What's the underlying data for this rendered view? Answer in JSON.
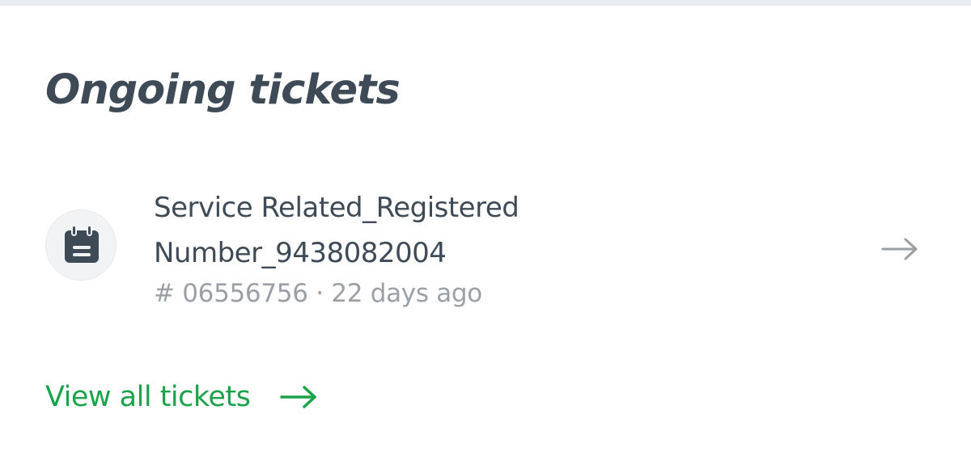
{
  "section": {
    "title": "Ongoing tickets"
  },
  "ticket": {
    "icon": "calendar-icon",
    "title": "Service Related_Registered Number_9438082004",
    "number": "# 06556756",
    "separator": "·",
    "age": "22 days ago",
    "arrow_icon": "arrow-right-icon"
  },
  "footer": {
    "view_all_label": "View all tickets",
    "view_all_icon": "arrow-right-icon"
  },
  "colors": {
    "text_primary": "#3e4b56",
    "text_muted": "#9aa0a6",
    "accent_green": "#1aa34a",
    "icon_bg": "#f1f3f5"
  }
}
